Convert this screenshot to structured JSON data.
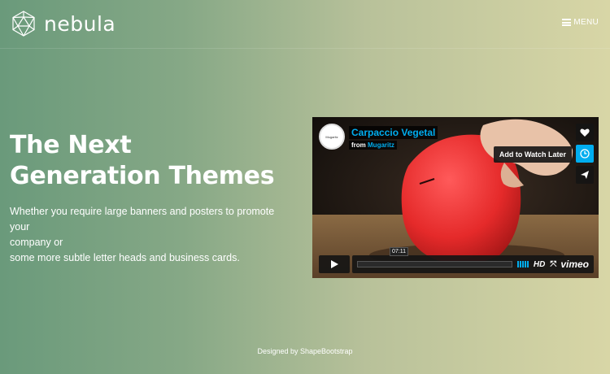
{
  "brand": {
    "name": "nebula",
    "icon": "geodesic-sphere-icon"
  },
  "nav": {
    "menu_label": "MENU",
    "menu_icon": "hamburger-icon"
  },
  "hero": {
    "title_line1": "The Next",
    "title_line2": "Generation Themes",
    "subtitle_line1": "Whether you require large banners and posters to promote your",
    "subtitle_line2": "company or",
    "subtitle_line3": "some more subtle letter heads and business cards."
  },
  "video": {
    "title": "Carpaccio Vegetal",
    "from_prefix": "from",
    "author": "Mugaritz",
    "logo_text": "Mugaritz",
    "watch_later_tooltip": "Add to Watch Later",
    "current_time": "07:11",
    "hd_label": "HD",
    "brand": "vimeo",
    "icons": [
      "heart-icon",
      "clock-icon",
      "send-icon",
      "play-icon",
      "fullscreen-icon"
    ]
  },
  "footer": {
    "credit": "Designed by ShapeBootstrap"
  },
  "colors": {
    "accent": "#00adef",
    "gradient_start": "#6a9a7b",
    "gradient_end": "#d8d6a6"
  }
}
